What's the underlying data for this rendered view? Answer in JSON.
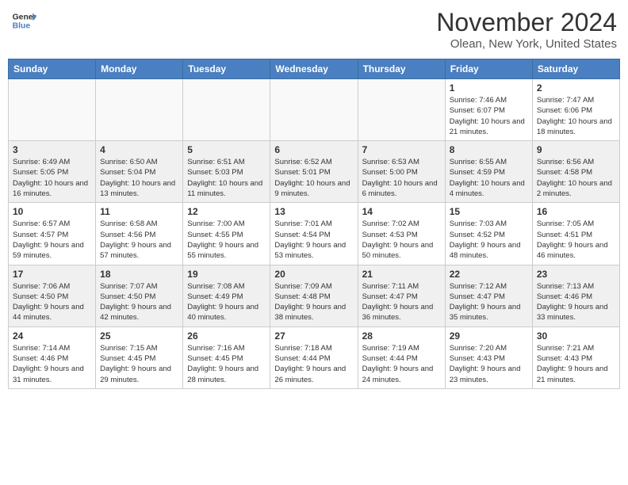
{
  "header": {
    "logo_general": "General",
    "logo_blue": "Blue",
    "month_title": "November 2024",
    "location": "Olean, New York, United States"
  },
  "days_of_week": [
    "Sunday",
    "Monday",
    "Tuesday",
    "Wednesday",
    "Thursday",
    "Friday",
    "Saturday"
  ],
  "weeks": [
    {
      "shaded": false,
      "days": [
        {
          "num": "",
          "info": ""
        },
        {
          "num": "",
          "info": ""
        },
        {
          "num": "",
          "info": ""
        },
        {
          "num": "",
          "info": ""
        },
        {
          "num": "",
          "info": ""
        },
        {
          "num": "1",
          "info": "Sunrise: 7:46 AM\nSunset: 6:07 PM\nDaylight: 10 hours and 21 minutes."
        },
        {
          "num": "2",
          "info": "Sunrise: 7:47 AM\nSunset: 6:06 PM\nDaylight: 10 hours and 18 minutes."
        }
      ]
    },
    {
      "shaded": true,
      "days": [
        {
          "num": "3",
          "info": "Sunrise: 6:49 AM\nSunset: 5:05 PM\nDaylight: 10 hours and 16 minutes."
        },
        {
          "num": "4",
          "info": "Sunrise: 6:50 AM\nSunset: 5:04 PM\nDaylight: 10 hours and 13 minutes."
        },
        {
          "num": "5",
          "info": "Sunrise: 6:51 AM\nSunset: 5:03 PM\nDaylight: 10 hours and 11 minutes."
        },
        {
          "num": "6",
          "info": "Sunrise: 6:52 AM\nSunset: 5:01 PM\nDaylight: 10 hours and 9 minutes."
        },
        {
          "num": "7",
          "info": "Sunrise: 6:53 AM\nSunset: 5:00 PM\nDaylight: 10 hours and 6 minutes."
        },
        {
          "num": "8",
          "info": "Sunrise: 6:55 AM\nSunset: 4:59 PM\nDaylight: 10 hours and 4 minutes."
        },
        {
          "num": "9",
          "info": "Sunrise: 6:56 AM\nSunset: 4:58 PM\nDaylight: 10 hours and 2 minutes."
        }
      ]
    },
    {
      "shaded": false,
      "days": [
        {
          "num": "10",
          "info": "Sunrise: 6:57 AM\nSunset: 4:57 PM\nDaylight: 9 hours and 59 minutes."
        },
        {
          "num": "11",
          "info": "Sunrise: 6:58 AM\nSunset: 4:56 PM\nDaylight: 9 hours and 57 minutes."
        },
        {
          "num": "12",
          "info": "Sunrise: 7:00 AM\nSunset: 4:55 PM\nDaylight: 9 hours and 55 minutes."
        },
        {
          "num": "13",
          "info": "Sunrise: 7:01 AM\nSunset: 4:54 PM\nDaylight: 9 hours and 53 minutes."
        },
        {
          "num": "14",
          "info": "Sunrise: 7:02 AM\nSunset: 4:53 PM\nDaylight: 9 hours and 50 minutes."
        },
        {
          "num": "15",
          "info": "Sunrise: 7:03 AM\nSunset: 4:52 PM\nDaylight: 9 hours and 48 minutes."
        },
        {
          "num": "16",
          "info": "Sunrise: 7:05 AM\nSunset: 4:51 PM\nDaylight: 9 hours and 46 minutes."
        }
      ]
    },
    {
      "shaded": true,
      "days": [
        {
          "num": "17",
          "info": "Sunrise: 7:06 AM\nSunset: 4:50 PM\nDaylight: 9 hours and 44 minutes."
        },
        {
          "num": "18",
          "info": "Sunrise: 7:07 AM\nSunset: 4:50 PM\nDaylight: 9 hours and 42 minutes."
        },
        {
          "num": "19",
          "info": "Sunrise: 7:08 AM\nSunset: 4:49 PM\nDaylight: 9 hours and 40 minutes."
        },
        {
          "num": "20",
          "info": "Sunrise: 7:09 AM\nSunset: 4:48 PM\nDaylight: 9 hours and 38 minutes."
        },
        {
          "num": "21",
          "info": "Sunrise: 7:11 AM\nSunset: 4:47 PM\nDaylight: 9 hours and 36 minutes."
        },
        {
          "num": "22",
          "info": "Sunrise: 7:12 AM\nSunset: 4:47 PM\nDaylight: 9 hours and 35 minutes."
        },
        {
          "num": "23",
          "info": "Sunrise: 7:13 AM\nSunset: 4:46 PM\nDaylight: 9 hours and 33 minutes."
        }
      ]
    },
    {
      "shaded": false,
      "days": [
        {
          "num": "24",
          "info": "Sunrise: 7:14 AM\nSunset: 4:46 PM\nDaylight: 9 hours and 31 minutes."
        },
        {
          "num": "25",
          "info": "Sunrise: 7:15 AM\nSunset: 4:45 PM\nDaylight: 9 hours and 29 minutes."
        },
        {
          "num": "26",
          "info": "Sunrise: 7:16 AM\nSunset: 4:45 PM\nDaylight: 9 hours and 28 minutes."
        },
        {
          "num": "27",
          "info": "Sunrise: 7:18 AM\nSunset: 4:44 PM\nDaylight: 9 hours and 26 minutes."
        },
        {
          "num": "28",
          "info": "Sunrise: 7:19 AM\nSunset: 4:44 PM\nDaylight: 9 hours and 24 minutes."
        },
        {
          "num": "29",
          "info": "Sunrise: 7:20 AM\nSunset: 4:43 PM\nDaylight: 9 hours and 23 minutes."
        },
        {
          "num": "30",
          "info": "Sunrise: 7:21 AM\nSunset: 4:43 PM\nDaylight: 9 hours and 21 minutes."
        }
      ]
    }
  ]
}
